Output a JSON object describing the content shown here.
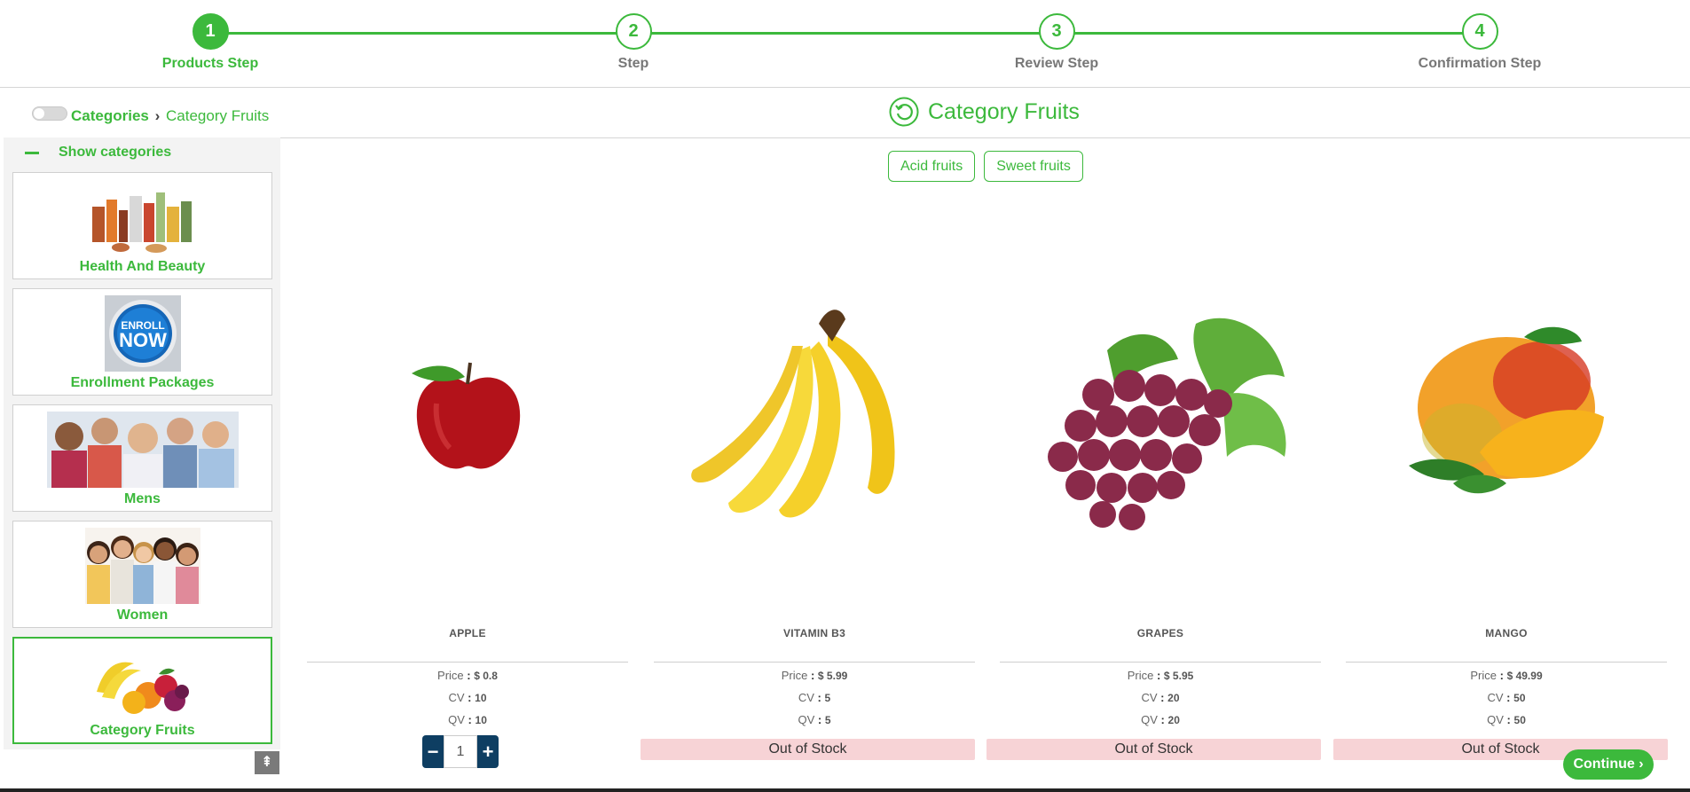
{
  "stepper": {
    "steps": [
      {
        "number": "1",
        "label": "Products Step",
        "active": true
      },
      {
        "number": "2",
        "label": "Step",
        "active": false
      },
      {
        "number": "3",
        "label": "Review Step",
        "active": false
      },
      {
        "number": "4",
        "label": "Confirmation Step",
        "active": false
      }
    ]
  },
  "breadcrumb": {
    "root": "Categories",
    "separator": "›",
    "current": "Category Fruits"
  },
  "page_title": "Category Fruits",
  "sidebar": {
    "toggle_label": "Show categories",
    "categories": [
      {
        "label": "Health And Beauty",
        "icon": "cosmetics-image"
      },
      {
        "label": "Enrollment Packages",
        "icon": "enroll-now-badge"
      },
      {
        "label": "Mens",
        "icon": "men-group-image"
      },
      {
        "label": "Women",
        "icon": "women-group-image"
      },
      {
        "label": "Category Fruits",
        "icon": "fruits-image",
        "active": true
      }
    ],
    "enroll_text_1": "ENROLL",
    "enroll_text_2": "NOW"
  },
  "filters": [
    "Acid fruits",
    "Sweet fruits"
  ],
  "labels": {
    "price": "Price",
    "cv": "CV",
    "qv": "QV",
    "colon": ":",
    "out_of_stock": "Out of Stock"
  },
  "products": [
    {
      "name": "APPLE",
      "price": "$ 0.8",
      "cv": "10",
      "qv": "10",
      "in_stock": true,
      "quantity": "1",
      "image": "apple-image"
    },
    {
      "name": "VITAMIN B3",
      "price": "$ 5.99",
      "cv": "5",
      "qv": "5",
      "in_stock": false,
      "image": "banana-image"
    },
    {
      "name": "GRAPES",
      "price": "$ 5.95",
      "cv": "20",
      "qv": "20",
      "in_stock": false,
      "image": "grapes-image"
    },
    {
      "name": "MANGO",
      "price": "$ 49.99",
      "cv": "50",
      "qv": "50",
      "in_stock": false,
      "image": "mango-image"
    }
  ],
  "quantity": {
    "minus": "−",
    "plus": "+"
  },
  "continue_label": "Continue ›",
  "scroll_top": "⇞",
  "colors": {
    "accent": "#3cb93c",
    "stock_bg": "#f7d3d6",
    "qty_btn": "#0e3e62"
  }
}
